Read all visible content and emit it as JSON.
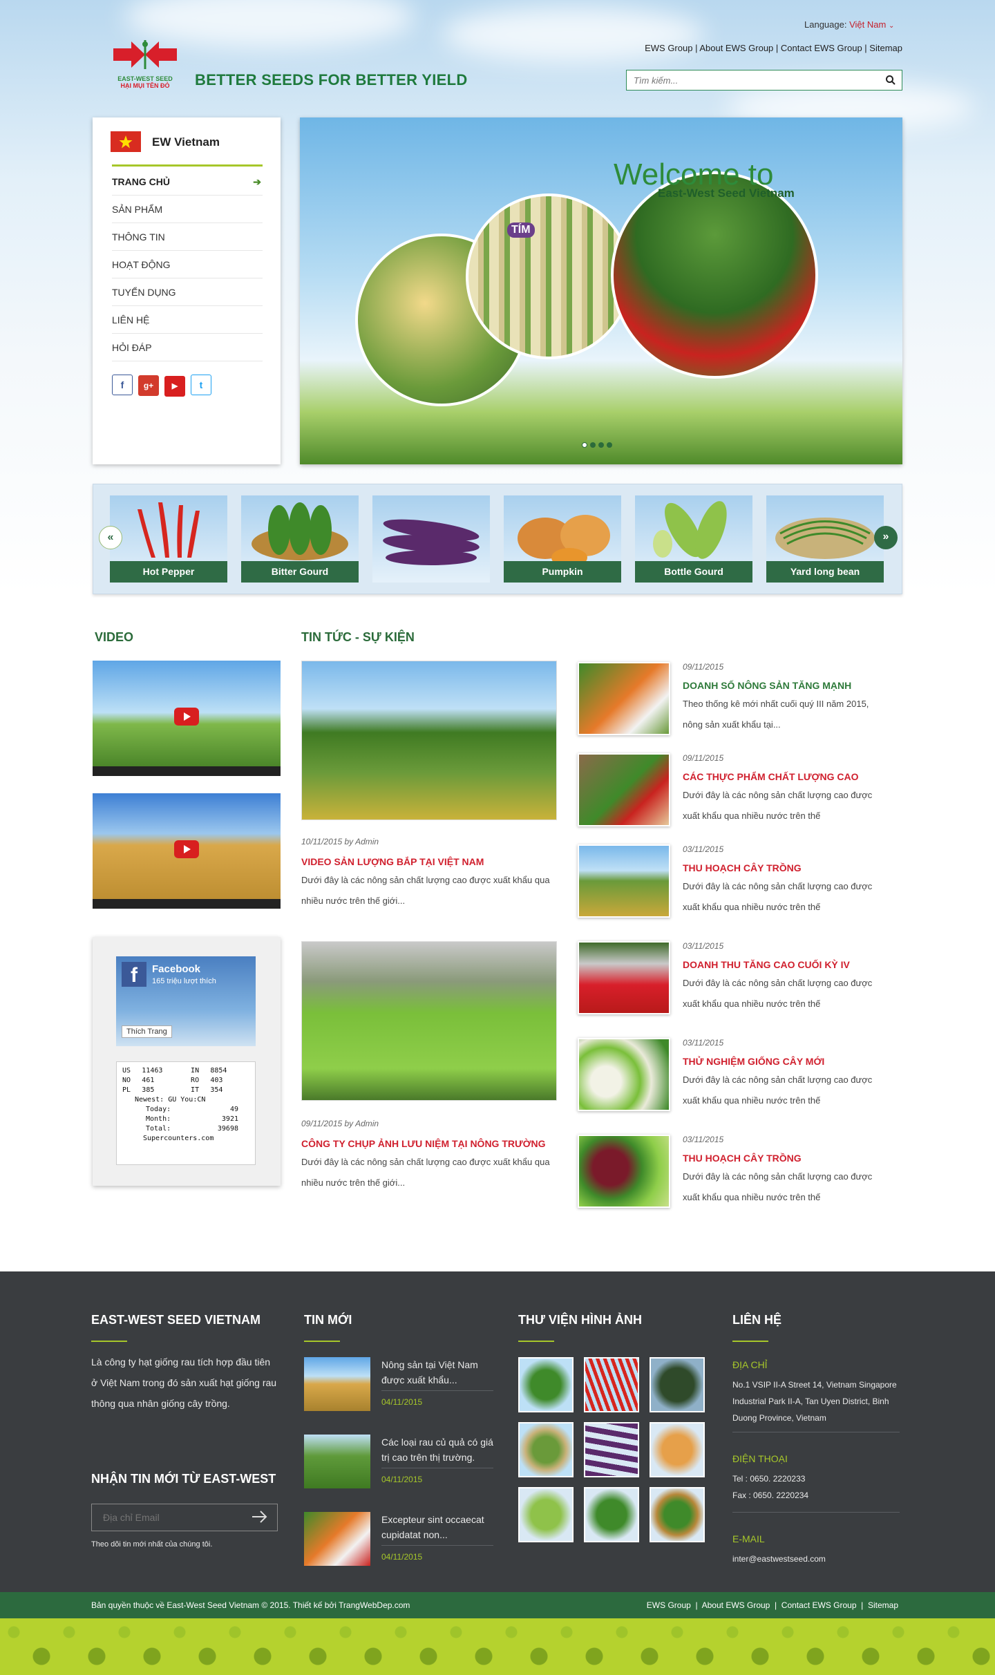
{
  "header": {
    "language_label": "Language:",
    "language_value": "Việt Nam",
    "top_links": [
      "EWS Group",
      "About EWS Group",
      "Contact EWS Group",
      "Sitemap"
    ],
    "search_placeholder": "Tìm kiếm...",
    "logo_text_1": "EAST-WEST SEED",
    "logo_text_2": "HẠI MỤI TÊN ĐỎ",
    "slogan": "BETTER SEEDS FOR BETTER YIELD"
  },
  "sidebar": {
    "brand": "EW Vietnam",
    "menu": [
      "TRANG CHỦ",
      "SẢN PHẨM",
      "THÔNG TIN",
      "HOẠT ĐỘNG",
      "TUYỂN DỤNG",
      "LIÊN HỆ",
      "HỎI ĐÁP"
    ],
    "social": [
      "f",
      "g+",
      "▶",
      "t"
    ]
  },
  "slider": {
    "title": "Welcome to",
    "subtitle": "East-West Seed Vietnam",
    "badge": "TÍM"
  },
  "products": [
    "Hot Pepper",
    "Bitter Gourd",
    "",
    "Pumpkin",
    "Bottle Gourd",
    "Yard long bean"
  ],
  "video": {
    "heading": "VIDEO"
  },
  "news": {
    "heading": "TIN TỨC - SỰ KIỆN",
    "featured": [
      {
        "meta": "10/11/2015 by Admin",
        "title": "VIDEO SẢN LƯỢNG BẮP TẠI VIỆT NAM",
        "desc": "Dưới đây là các nông sản chất lượng cao được xuất khẩu qua nhiều nước trên thế giới..."
      },
      {
        "meta": "09/11/2015 by Admin",
        "title": "CÔNG TY CHỤP ẢNH LƯU NIỆM TẠI NÔNG TRƯỜNG",
        "desc": "Dưới đây là các nông sản chất lượng cao được xuất khẩu qua nhiều nước trên thế giới..."
      }
    ],
    "list": [
      {
        "date": "09/11/2015",
        "title": "DOANH SỐ NÔNG SẢN TĂNG MẠNH",
        "desc": "Theo thống kê mới nhất cuối quý III năm 2015, nông sản xuất khẩu tại..."
      },
      {
        "date": "09/11/2015",
        "title": "CÁC THỰC PHẨM CHẤT LƯỢNG CAO",
        "desc": "Dưới đây là các nông sản chất lượng cao được xuất khẩu qua nhiều nước trên thế"
      },
      {
        "date": "03/11/2015",
        "title": "THU HOẠCH CÂY TRỒNG",
        "desc": "Dưới đây là các nông sản chất lượng cao được xuất khẩu qua nhiều nước trên thế"
      },
      {
        "date": "03/11/2015",
        "title": "DOANH THU TĂNG CAO CUỐI KỲ IV",
        "desc": "Dưới đây là các nông sản chất lượng cao được xuất khẩu qua nhiều nước trên thế"
      },
      {
        "date": "03/11/2015",
        "title": "THỬ NGHIỆM GIỐNG CÂY MỚI",
        "desc": "Dưới đây là các nông sản chất lượng cao được xuất khẩu qua nhiều nước trên thế"
      },
      {
        "date": "03/11/2015",
        "title": "THU HOẠCH CÂY TRỒNG",
        "desc": "Dưới đây là các nông sản chất lượng cao được xuất khẩu qua nhiều nước trên thế"
      }
    ]
  },
  "facebook": {
    "title": "Facebook",
    "likes": "165 triệu lượt thích",
    "like_button": "Thích Trang"
  },
  "counter": {
    "rows": [
      [
        "US",
        "11463",
        "IN",
        "8854"
      ],
      [
        "NO",
        "461",
        "RO",
        "403"
      ],
      [
        "PL",
        "385",
        "IT",
        "354"
      ]
    ],
    "newest_label": "Newest:",
    "newest_1": "GU",
    "you_label": "You:",
    "you_value": "CN",
    "today_label": "Today:",
    "today": "49",
    "month_label": "Month:",
    "month": "3921",
    "total_label": "Total:",
    "total": "39698",
    "credit": "Supercounters.com"
  },
  "footer": {
    "about_heading": "EAST-WEST SEED VIETNAM",
    "about_text": "Là công ty hạt giống rau tích hợp đầu tiên ở Việt Nam trong đó sản xuất hạt giống rau thông qua nhân giống cây trồng.",
    "newsletter_heading": "NHẬN TIN MỚI TỪ EAST-WEST",
    "newsletter_placeholder": "Địa chỉ Email",
    "newsletter_note": "Theo dõi tin mới nhất của chúng tôi.",
    "news_heading": "TIN MỚI",
    "news": [
      {
        "title": "Nông sản tại Việt Nam được xuất khẩu...",
        "date": "04/11/2015"
      },
      {
        "title": "Các loại rau củ quả có giá trị cao trên thị trường.",
        "date": "04/11/2015"
      },
      {
        "title": "Excepteur sint occaecat cupidatat non...",
        "date": "04/11/2015"
      }
    ],
    "gallery_heading": "THƯ VIỆN HÌNH ẢNH",
    "contact_heading": "LIÊN HỆ",
    "address_label": "ĐỊA CHỈ",
    "address": "No.1 VSIP II-A Street 14, Vietnam Singapore Industrial Park II-A,  Tan Uyen District, Binh Duong Province, Vietnam",
    "phone_label": "ĐIỆN THOẠI",
    "tel": "Tel : 0650. 2220233",
    "fax": "Fax : 0650. 2220234",
    "email_label": "E-MAIL",
    "email": "inter@eastwestseed.com"
  },
  "bottom": {
    "copyright": "Bản quyền thuộc về East-West Seed Vietnam © 2015. Thiết kế bởi TrangWebDep.com",
    "links": [
      "EWS Group",
      "About EWS Group",
      "Contact EWS Group",
      "Sitemap"
    ]
  }
}
